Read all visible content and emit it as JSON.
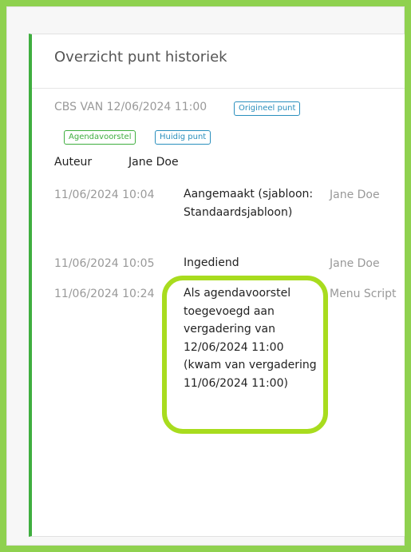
{
  "panel": {
    "title": "Overzicht punt historiek",
    "meeting": "CBS VAN 12/06/2024 11:00",
    "badges": {
      "original": "Origineel punt",
      "proposal": "Agendavoorstel",
      "current": "Huidig punt"
    },
    "author_label": "Auteur",
    "author_name": "Jane Doe"
  },
  "history": [
    {
      "time": "11/06/2024 10:04",
      "description": "Aangemaakt (sjabloon: Standaardsjabloon)",
      "user": "Jane Doe"
    },
    {
      "time": "11/06/2024 10:05",
      "description": "Ingediend",
      "user": "Jane Doe"
    },
    {
      "time": "11/06/2024 10:24",
      "description": "Als agendavoorstel toegevoegd aan vergadering van 12/06/2024 11:00 (kwam van vergadering 11/06/2024 11:00)",
      "user": "Menu Script"
    }
  ],
  "colors": {
    "accent_green": "#3fae3f",
    "badge_blue": "#2a8fbd",
    "highlight": "#a8dc1e",
    "frame": "#8fd14f"
  }
}
